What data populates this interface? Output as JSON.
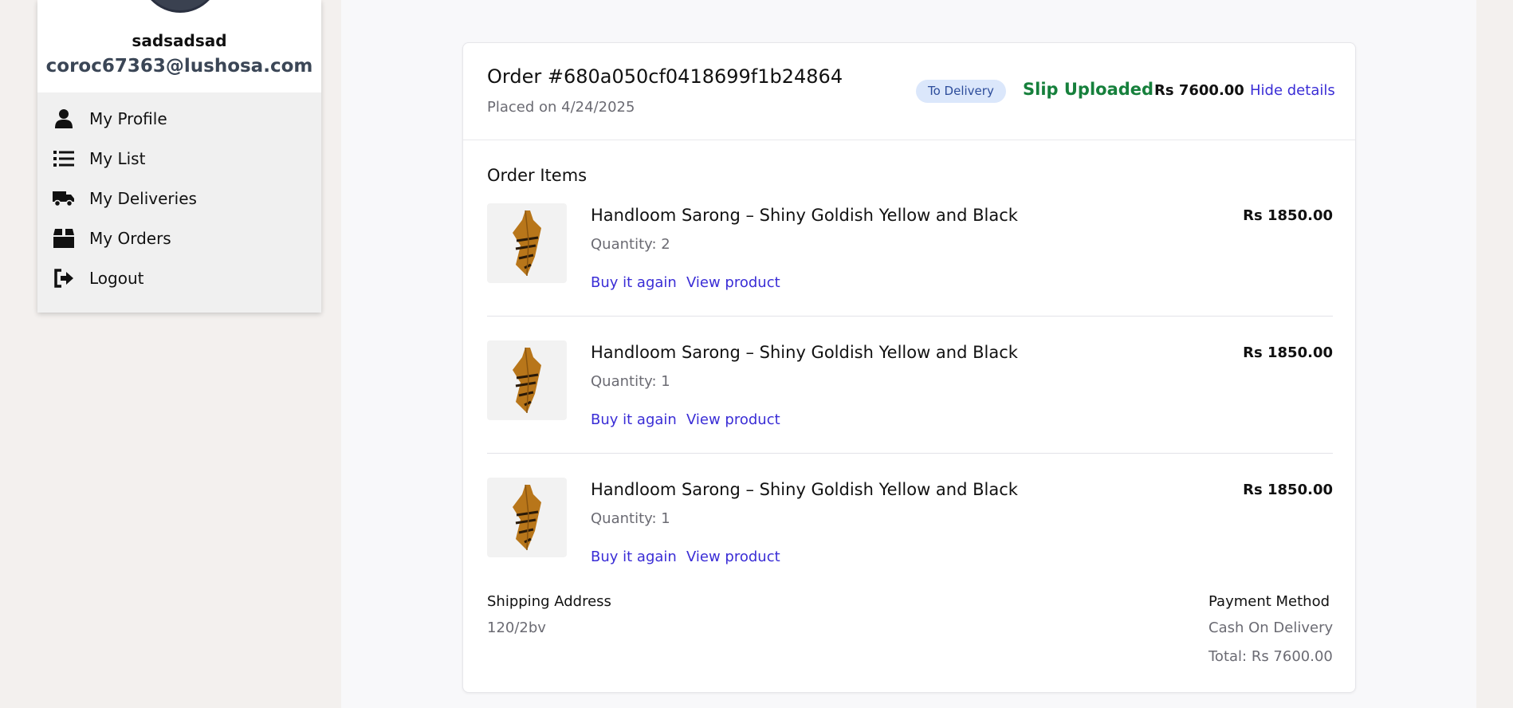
{
  "user": {
    "name": "sadsadsad",
    "email": "coroc67363@lushosa.com"
  },
  "menu": [
    {
      "label": "My Profile",
      "icon": "user-icon"
    },
    {
      "label": "My List",
      "icon": "list-icon"
    },
    {
      "label": "My Deliveries",
      "icon": "truck-icon"
    },
    {
      "label": "My Orders",
      "icon": "box-icon"
    },
    {
      "label": "Logout",
      "icon": "logout-icon"
    }
  ],
  "order": {
    "id": "Order #680a050cf0418699f1b24864",
    "placed": "Placed on 4/24/2025",
    "status_badge": "To Delivery",
    "slip_status": "Slip Uploaded",
    "total": "Rs 7600.00",
    "toggle_label": "Hide details",
    "items_title": "Order Items",
    "items": [
      {
        "name": "Handloom Sarong – Shiny Goldish Yellow and Black",
        "quantity": "Quantity: 2",
        "price": "Rs 1850.00",
        "buy_label": "Buy it again",
        "view_label": "View product"
      },
      {
        "name": "Handloom Sarong – Shiny Goldish Yellow and Black",
        "quantity": "Quantity: 1",
        "price": "Rs 1850.00",
        "buy_label": "Buy it again",
        "view_label": "View product"
      },
      {
        "name": "Handloom Sarong – Shiny Goldish Yellow and Black",
        "quantity": "Quantity: 1",
        "price": "Rs 1850.00",
        "buy_label": "Buy it again",
        "view_label": "View product"
      }
    ],
    "shipping_title": "Shipping Address",
    "shipping_address": "120/2bv",
    "payment_title": "Payment Method",
    "payment_method": "Cash On Delivery",
    "payment_total": "Total: Rs 7600.00"
  },
  "colors": {
    "link": "#3a2dd6",
    "slip_green": "#16803c",
    "badge_bg": "#dbe7fb",
    "badge_text": "#2d4d9b"
  }
}
